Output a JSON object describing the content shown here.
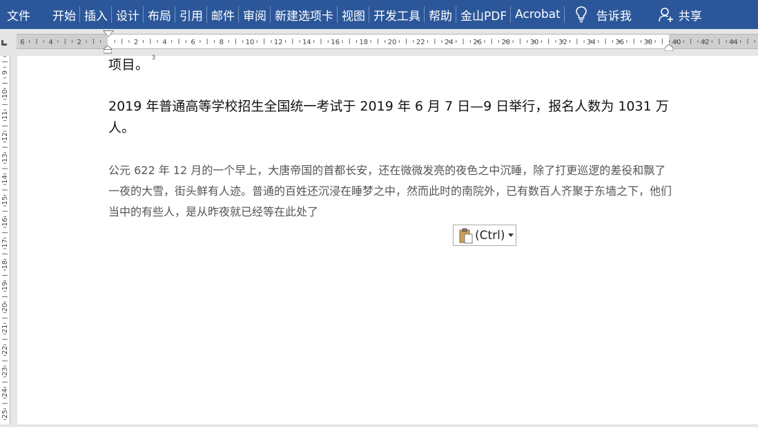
{
  "ribbon": {
    "file": "文件",
    "tabs": [
      "开始",
      "插入",
      "设计",
      "布局",
      "引用",
      "邮件",
      "审阅",
      "新建选项卡",
      "视图",
      "开发工具",
      "帮助",
      "金山PDF",
      "Acrobat"
    ],
    "tell_me": "告诉我",
    "share": "共享",
    "background_color": "#2b579a"
  },
  "ruler": {
    "numbers": [
      "6",
      "4",
      "2",
      "2",
      "4",
      "6",
      "8",
      "10",
      "12",
      "14",
      "16",
      "18",
      "20",
      "22",
      "24",
      "26",
      "28",
      "30",
      "32",
      "34",
      "36",
      "38",
      "40",
      "42",
      "44"
    ],
    "vertical_numbers": [
      "9",
      "10",
      "11",
      "12",
      "13",
      "14",
      "15",
      "16",
      "17",
      "18",
      "19",
      "20",
      "21",
      "22",
      "23",
      "24",
      "25"
    ]
  },
  "document": {
    "para1": "项目。",
    "para1_footnote": "3",
    "para2": "2019 年普通高等学校招生全国统一考试于 2019 年 6 月 7 日—9 日举行，报名人数为 1031 万人。",
    "para3": "公元 622 年 12 月的一个早上，大唐帝国的首都长安，还在微微发亮的夜色之中沉睡，除了打更巡逻的差役和飘了一夜的大雪，街头鲜有人迹。普通的百姓还沉浸在睡梦之中，然而此时的南院外，已有数百人齐聚于东墙之下，他们当中的有些人，是从昨夜就已经等在此处了"
  },
  "paste_options": {
    "label": "(Ctrl)",
    "icon": "clipboard-icon"
  }
}
